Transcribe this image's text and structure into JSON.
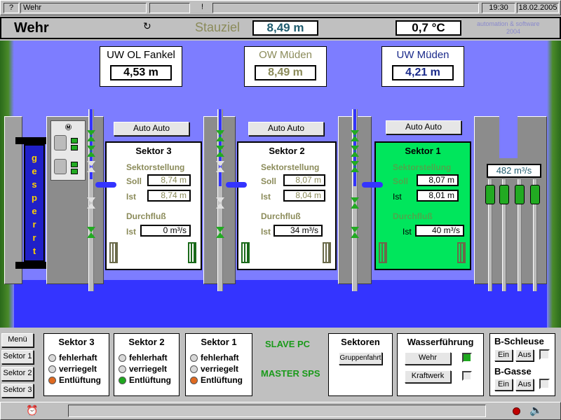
{
  "titlebar": {
    "help": "?",
    "title": "Wehr",
    "mid": "!",
    "time": "19:30",
    "date": "18.02.2005"
  },
  "header": {
    "page_title": "Wehr",
    "stauziel_label": "Stauziel",
    "stauziel_value": "8,49 m",
    "temperature": "0,7 °C",
    "brand_line1": "automation & software",
    "brand_line2": "2004"
  },
  "levels": [
    {
      "label": "UW OL Fankel",
      "value": "4,53 m"
    },
    {
      "label": "OW Müden",
      "value": "8,49 m"
    },
    {
      "label": "UW Müden",
      "value": "4,21 m"
    }
  ],
  "gesperrt": [
    "g",
    "e",
    "s",
    "p",
    "e",
    "r",
    "r",
    "t"
  ],
  "sectors": [
    {
      "name": "Sektor 3",
      "mode": "Auto Auto",
      "stellung_label": "Sektorstellung",
      "soll_label": "Soll",
      "soll": "8,74 m",
      "ist_label": "Ist",
      "ist": "8,74 m",
      "durchfluss_label": "Durchfluß",
      "q_ist_label": "Ist",
      "q_ist": "0 m³/s"
    },
    {
      "name": "Sektor 2",
      "mode": "Auto Auto",
      "stellung_label": "Sektorstellung",
      "soll_label": "Soll",
      "soll": "8,07 m",
      "ist_label": "Ist",
      "ist": "8,04 m",
      "durchfluss_label": "Durchfluß",
      "q_ist_label": "Ist",
      "q_ist": "34 m³/s"
    },
    {
      "name": "Sektor 1",
      "mode": "Auto Auto",
      "stellung_label": "Sektorstellung",
      "soll_label": "Soll",
      "soll": "8,07 m",
      "ist_label": "Ist",
      "ist": "8,01 m",
      "durchfluss_label": "Durchfluß",
      "q_ist_label": "Ist",
      "q_ist": "40 m³/s"
    }
  ],
  "total_flow": "482 m³/s",
  "sidebar": [
    "Menü",
    "Sektor 1",
    "Sektor 2",
    "Sektor 3"
  ],
  "status": [
    {
      "name": "Sektor 3",
      "rows": [
        {
          "label": "fehlerhaft",
          "color": "#d8d8d8"
        },
        {
          "label": "verriegelt",
          "color": "#d8d8d8"
        },
        {
          "label": "Entlüftung",
          "color": "#e06a20"
        }
      ]
    },
    {
      "name": "Sektor 2",
      "rows": [
        {
          "label": "fehlerhaft",
          "color": "#d8d8d8"
        },
        {
          "label": "verriegelt",
          "color": "#d8d8d8"
        },
        {
          "label": "Entlüftung",
          "color": "#1fa81f"
        }
      ]
    },
    {
      "name": "Sektor 1",
      "rows": [
        {
          "label": "fehlerhaft",
          "color": "#d8d8d8"
        },
        {
          "label": "verriegelt",
          "color": "#d8d8d8"
        },
        {
          "label": "Entlüftung",
          "color": "#e06a20"
        }
      ]
    }
  ],
  "pcs": {
    "slave": "SLAVE PC",
    "master": "MASTER SPS"
  },
  "sektoren": {
    "title": "Sektoren",
    "button": "Gruppenfahrt"
  },
  "wasser": {
    "title": "Wasserführung",
    "wehr": "Wehr",
    "kraftwerk": "Kraftwerk"
  },
  "schleuse": {
    "title1": "B-Schleuse",
    "title2": "B-Gasse",
    "ein": "Ein",
    "aus": "Aus"
  },
  "colors": {
    "water": "#3434ff",
    "sky": "#7d7dff",
    "active": "#00e65c",
    "valve": "#22aa22"
  }
}
